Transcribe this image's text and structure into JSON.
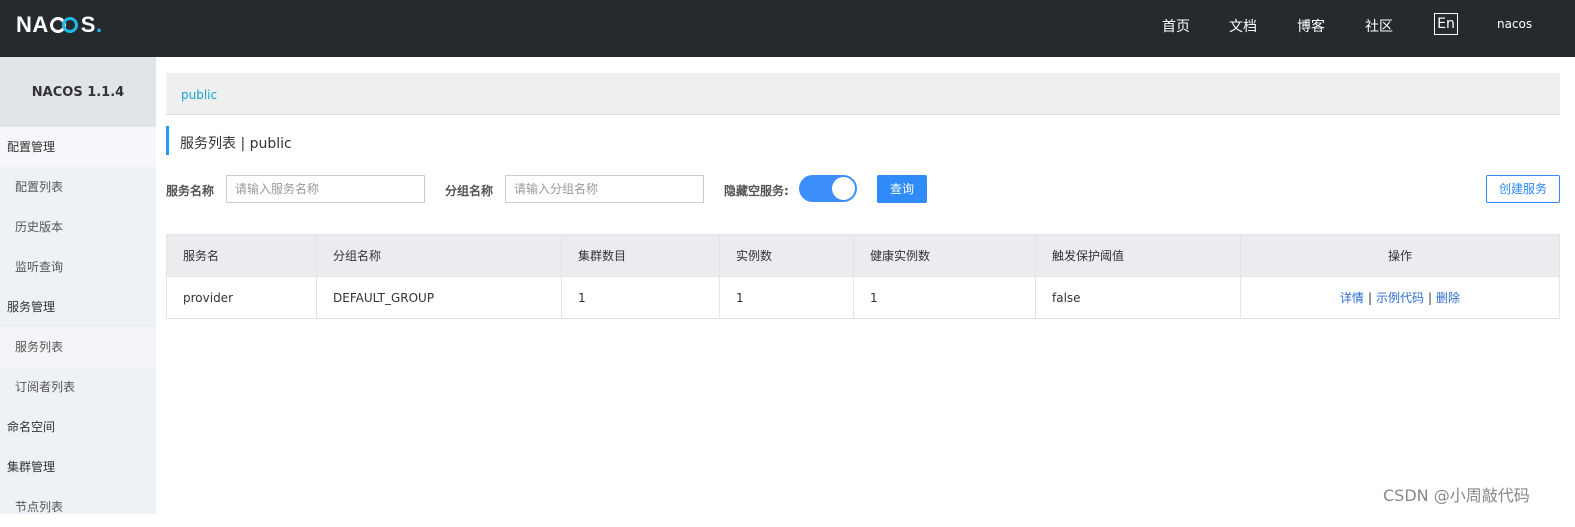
{
  "header": {
    "logo": {
      "n": "NA",
      "rest": "S",
      "dot": "."
    },
    "nav": [
      {
        "label": "首页"
      },
      {
        "label": "文档"
      },
      {
        "label": "博客"
      },
      {
        "label": "社区"
      }
    ],
    "lang": "En",
    "user": "nacos"
  },
  "sidebar": {
    "title": "NACOS 1.1.4",
    "items": [
      {
        "label": "配置管理",
        "type": "group"
      },
      {
        "label": "配置列表",
        "type": "sub"
      },
      {
        "label": "历史版本",
        "type": "sub"
      },
      {
        "label": "监听查询",
        "type": "sub"
      },
      {
        "label": "服务管理",
        "type": "group"
      },
      {
        "label": "服务列表",
        "type": "sub",
        "active": true
      },
      {
        "label": "订阅者列表",
        "type": "sub"
      },
      {
        "label": "命名空间",
        "type": "group"
      },
      {
        "label": "集群管理",
        "type": "group"
      },
      {
        "label": "节点列表",
        "type": "sub"
      }
    ]
  },
  "breadcrumb": "public",
  "page_title": "服务列表 | public",
  "filters": {
    "service_name_label": "服务名称",
    "service_name_placeholder": "请输入服务名称",
    "group_name_label": "分组名称",
    "group_name_placeholder": "请输入分组名称",
    "hide_empty_label": "隐藏空服务:",
    "hide_empty_on": true,
    "query_label": "查询",
    "create_label": "创建服务"
  },
  "table": {
    "columns": [
      "服务名",
      "分组名称",
      "集群数目",
      "实例数",
      "健康实例数",
      "触发保护阈值",
      "操作"
    ],
    "rows": [
      {
        "service": "provider",
        "group": "DEFAULT_GROUP",
        "clusters": "1",
        "instances": "1",
        "healthy": "1",
        "threshold": "false",
        "actions": [
          "详情",
          "示例代码",
          "删除"
        ]
      }
    ]
  },
  "watermark": "CSDN @小周敲代码",
  "colors": {
    "topbar": "#252a2f",
    "accent": "#2e8bf7",
    "link": "#2a6ecf"
  }
}
